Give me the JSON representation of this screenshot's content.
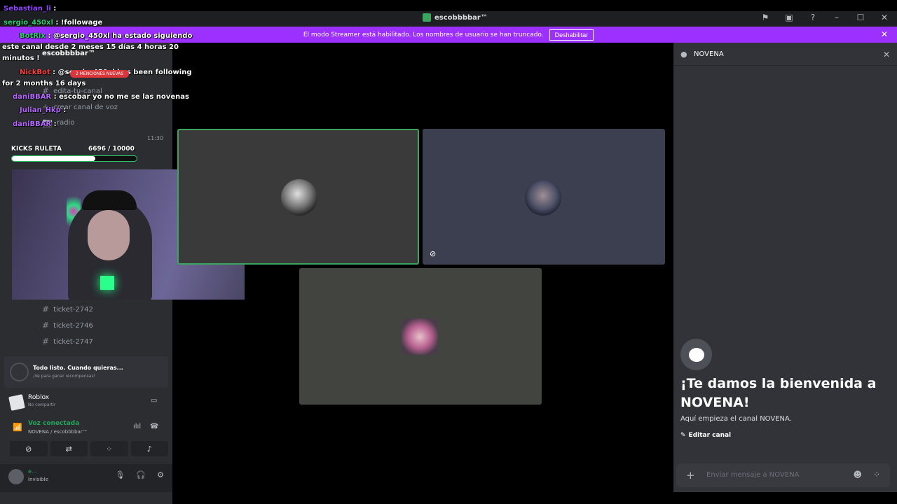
{
  "window": {
    "title": "escobbbbar™"
  },
  "banner": {
    "text": "El modo Streamer está habilitado. Los nombres de usuario se han truncado.",
    "button": "Deshabilitar"
  },
  "server": {
    "name": "escobbbbar™"
  },
  "stream_chat": [
    {
      "user": "Sebastian_li",
      "message": ":"
    },
    {
      "user": "sergio_450xl",
      "message": ": !followage"
    },
    {
      "user": "BotRix",
      "message": ": @sergio_450xl ha estado siguiendo"
    },
    {
      "user": "",
      "message": "este canal desde 2 meses 15 días 4 horas 20"
    },
    {
      "user": "",
      "message": "minutos !"
    },
    {
      "user": "NickBot",
      "message": ": @sergio_450xl has been following"
    },
    {
      "user": "",
      "message": "for 2 months 16 days"
    },
    {
      "user": "daniBBAR",
      "message": ": escobar yo no me se las novenas"
    },
    {
      "user": "Julian_Hkp",
      "message": ":"
    },
    {
      "user": "daniBBAR",
      "message": ":"
    }
  ],
  "mentions_pill": "2 MENCIONES NUEVAS",
  "roulette": {
    "label": "KICKS RULETA",
    "count": "6696  / 10000",
    "progress": 0.6696
  },
  "chat_time": "11:30",
  "channels_top": [
    {
      "name": "edita-tu-canal"
    },
    {
      "name": "crear canal de voz"
    },
    {
      "name": "radio"
    }
  ],
  "channels": [
    {
      "name": "ticket-2742"
    },
    {
      "name": "ticket-2746"
    },
    {
      "name": "ticket-2747"
    }
  ],
  "quest": {
    "title": "Todo listo. Cuando quieras...",
    "subtitle": "¡Ve para ganar recompensas!"
  },
  "activity": {
    "name": "Roblox",
    "subtitle": "No compartir"
  },
  "voice": {
    "status": "Voz conectada",
    "channel": "NOVENA / escobbbbar™"
  },
  "user": {
    "name": "e...",
    "status": "Invisible"
  },
  "right_panel": {
    "channel": "NOVENA",
    "welcome": "¡Te damos la bienvenida a NOVENA!",
    "start": "Aquí empieza el canal NOVENA.",
    "edit": "Editar canal",
    "input_placeholder": "Enviar mensaje a NOVENA"
  },
  "colors": {
    "streamer_banner": "#9b30ff",
    "voice_connected": "#23a55a",
    "speaking_border": "#3ba55d"
  },
  "icons": {
    "titlebar": [
      "flag-icon",
      "inbox-icon",
      "help-icon",
      "minimize-icon",
      "maximize-icon",
      "close-icon"
    ]
  }
}
